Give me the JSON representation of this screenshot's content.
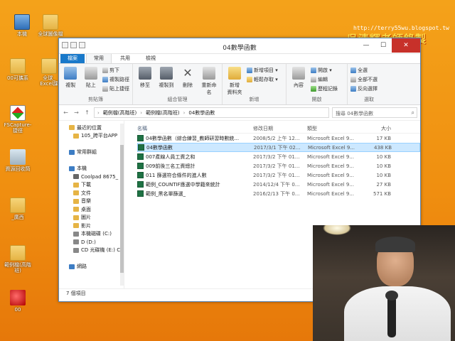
{
  "desktop": {
    "icons": [
      {
        "label": "本機",
        "kind": "pc"
      },
      {
        "label": "全球圖像檔",
        "kind": "folder"
      },
      {
        "label": "00可攜系",
        "kind": "folder"
      },
      {
        "label": "全球_\nExcel課",
        "kind": "folder"
      },
      {
        "label": "FSCapture-\n捷徑",
        "kind": "fsc"
      },
      {
        "label": "資源回收筒",
        "kind": "trash"
      },
      {
        "label": "_廣西",
        "kind": "folder"
      },
      {
        "label": "範例檔(高階班)",
        "kind": "folder"
      },
      {
        "label": "00",
        "kind": "redball"
      }
    ],
    "watermark_url": "http://terry55wu.blogspot.tw",
    "watermark_title": "吳清輝老師錄製"
  },
  "window": {
    "title": "04數學函數",
    "controls": {
      "minimize": "—",
      "maximize": "☐",
      "close": "✕"
    },
    "tabs": [
      "檔案",
      "常用",
      "共用",
      "檢視"
    ],
    "ribbon": {
      "clipboard": {
        "label": "剪貼簿",
        "copy": "複製",
        "paste": "貼上",
        "cut": "剪下",
        "copy_path": "複製路徑",
        "paste_shortcut": "貼上捷徑"
      },
      "organize": {
        "label": "組合管理",
        "move_to": "移至",
        "copy_to": "複製到",
        "delete": "刪除",
        "rename": "重新命名"
      },
      "new": {
        "label": "新增",
        "new_folder": "新增\n資料夾",
        "new_item": "新增項目 ▾",
        "easy_access": "輕鬆存取 ▾"
      },
      "open": {
        "label": "開啟",
        "properties": "內容",
        "open": "開啟 ▾",
        "edit": "編輯",
        "history": "歷程記錄"
      },
      "select": {
        "label": "選取",
        "select_all": "全選",
        "select_none": "全部不選",
        "invert": "反向選擇"
      }
    },
    "address": {
      "segments": [
        "範例檔(高階班)",
        "範例檔(高階班)",
        "04數學函數"
      ],
      "search_placeholder": "搜尋 04數學函數"
    },
    "nav_pane": [
      {
        "label": "105_跨平台APP",
        "icon": "folder"
      },
      {
        "label": "",
        "icon": ""
      },
      {
        "label": "常用群組",
        "icon": "group"
      },
      {
        "label": "",
        "icon": ""
      },
      {
        "label": "本機",
        "icon": "pc"
      },
      {
        "label": "Coolpad 8675_",
        "icon": "device"
      },
      {
        "label": "下載",
        "icon": "folder"
      },
      {
        "label": "文件",
        "icon": "folder"
      },
      {
        "label": "音樂",
        "icon": "folder"
      },
      {
        "label": "桌面",
        "icon": "folder"
      },
      {
        "label": "圖片",
        "icon": "folder"
      },
      {
        "label": "影片",
        "icon": "folder"
      },
      {
        "label": "本機磁碟 (C:)",
        "icon": "drive"
      },
      {
        "label": "D (D:)",
        "icon": "drive"
      },
      {
        "label": "CD 光碟機 (E:) C",
        "icon": "drive"
      },
      {
        "label": "",
        "icon": ""
      },
      {
        "label": "網路",
        "icon": "network"
      }
    ],
    "recent_label": "最近的位置",
    "columns": {
      "name": "名稱",
      "date": "修改日期",
      "type": "類型",
      "size": "大小"
    },
    "files": [
      {
        "name": "04數學函數（綜合練習_教師研習時數統...",
        "date": "2008/5/2 上午 12...",
        "type": "Microsoft Excel 9...",
        "size": "17 KB",
        "selected": false
      },
      {
        "name": "04數學函數",
        "date": "2017/3/1 下午 02...",
        "type": "Microsoft Excel 9...",
        "size": "438 KB",
        "selected": true
      },
      {
        "name": "007產線人員工資之和",
        "date": "2017/3/2 下午 01...",
        "type": "Microsoft Excel 9...",
        "size": "10 KB",
        "selected": false
      },
      {
        "name": "009前後三名工資總計",
        "date": "2017/3/2 下午 01...",
        "type": "Microsoft Excel 9...",
        "size": "10 KB",
        "selected": false
      },
      {
        "name": "011 篩選符合條件的進人數",
        "date": "2017/3/2 下午 01...",
        "type": "Microsoft Excel 9...",
        "size": "10 KB",
        "selected": false
      },
      {
        "name": "範例_COUNTIF應選中學籍來統計",
        "date": "2014/12/4 下午 0...",
        "type": "Microsoft Excel 9...",
        "size": "27 KB",
        "selected": false
      },
      {
        "name": "範例_黑名單篩選_",
        "date": "2016/2/13 下午 0...",
        "type": "Microsoft Excel 9...",
        "size": "571 KB",
        "selected": false
      }
    ],
    "status": "7 個項目"
  }
}
